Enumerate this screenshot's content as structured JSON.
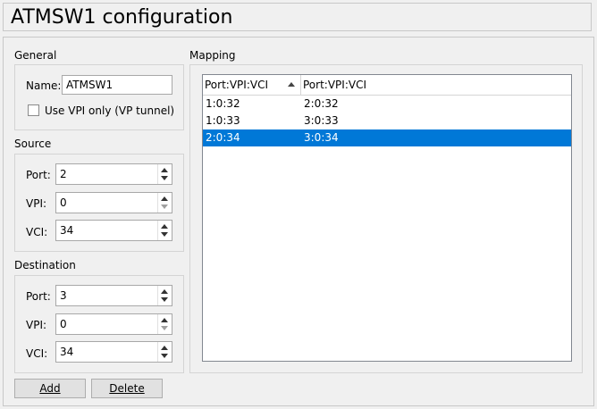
{
  "window": {
    "title": "ATMSW1 configuration"
  },
  "general": {
    "section_label": "General",
    "name_label": "Name:",
    "name_value": "ATMSW1",
    "vp_tunnel_label": "Use VPI only (VP tunnel)",
    "vp_tunnel_checked": false
  },
  "source": {
    "section_label": "Source",
    "port_label": "Port:",
    "port_value": "2",
    "vpi_label": "VPI:",
    "vpi_value": "0",
    "vci_label": "VCI:",
    "vci_value": "34"
  },
  "destination": {
    "section_label": "Destination",
    "port_label": "Port:",
    "port_value": "3",
    "vpi_label": "VPI:",
    "vpi_value": "0",
    "vci_label": "VCI:",
    "vci_value": "34"
  },
  "mapping": {
    "section_label": "Mapping",
    "columns": [
      "Port:VPI:VCI",
      "Port:VPI:VCI"
    ],
    "rows": [
      [
        "1:0:32",
        "2:0:32"
      ],
      [
        "1:0:33",
        "3:0:33"
      ],
      [
        "2:0:34",
        "3:0:34"
      ]
    ],
    "selected_row": 2
  },
  "buttons": {
    "add": "Add",
    "delete": "Delete"
  },
  "colors": {
    "selection": "#0078d7"
  }
}
